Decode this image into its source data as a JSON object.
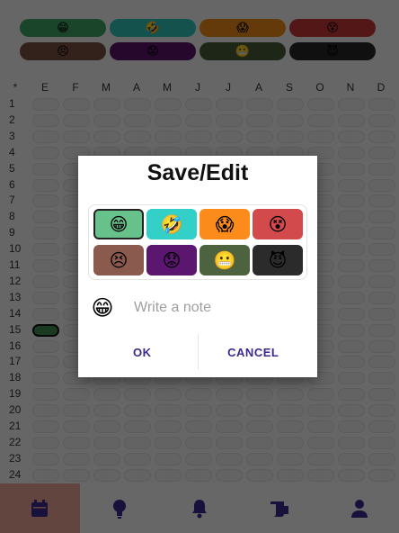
{
  "legend": [
    {
      "color": "#3fa565",
      "icon": "grinning-face-icon",
      "glyph": "😁"
    },
    {
      "color": "#2fc4b8",
      "icon": "laughing-face-icon",
      "glyph": "🤣"
    },
    {
      "color": "#f08a18",
      "icon": "shocked-face-icon",
      "glyph": "😱"
    },
    {
      "color": "#c9383a",
      "icon": "dizzy-face-icon",
      "glyph": "😵"
    },
    {
      "color": "#7b4f42",
      "icon": "sad-face-icon",
      "glyph": "😣"
    },
    {
      "color": "#5a1569",
      "icon": "worried-face-icon",
      "glyph": "😟"
    },
    {
      "color": "#465c37",
      "icon": "grimace-face-icon",
      "glyph": "😬"
    },
    {
      "color": "#262626",
      "icon": "devil-face-icon",
      "glyph": "😈"
    }
  ],
  "grid": {
    "corner": "*",
    "months": [
      "E",
      "F",
      "M",
      "A",
      "M",
      "J",
      "J",
      "A",
      "S",
      "O",
      "N",
      "D"
    ],
    "days": [
      "1",
      "2",
      "3",
      "4",
      "5",
      "6",
      "7",
      "8",
      "9",
      "10",
      "11",
      "12",
      "13",
      "14",
      "15",
      "16",
      "17",
      "18",
      "19",
      "20",
      "21",
      "22",
      "23",
      "24"
    ]
  },
  "dialog": {
    "title": "Save/Edit",
    "moods": [
      {
        "color": "#66c28a",
        "icon": "grinning-face-icon",
        "glyph": "😁",
        "selected": true
      },
      {
        "color": "#32d0c6",
        "icon": "laughing-face-icon",
        "glyph": "🤣",
        "selected": false
      },
      {
        "color": "#fb8c1c",
        "icon": "shocked-face-icon",
        "glyph": "😱",
        "selected": false
      },
      {
        "color": "#d24a4c",
        "icon": "dizzy-face-icon",
        "glyph": "😵",
        "selected": false
      },
      {
        "color": "#8a5a4f",
        "icon": "sad-face-icon",
        "glyph": "😣",
        "selected": false
      },
      {
        "color": "#5b1670",
        "icon": "worried-face-icon",
        "glyph": "😟",
        "selected": false
      },
      {
        "color": "#4d6340",
        "icon": "grimace-face-icon",
        "glyph": "😬",
        "selected": false
      },
      {
        "color": "#2b2b2b",
        "icon": "devil-face-icon",
        "glyph": "😈",
        "selected": false
      }
    ],
    "note_icon": "😁",
    "note_placeholder": "Write a note",
    "ok_label": "OK",
    "cancel_label": "CANCEL"
  },
  "tabbar": {
    "active_color": "#e8a493",
    "icon_color": "#3b2a8e",
    "tabs": [
      "calendar-icon",
      "lightbulb-icon",
      "bell-icon",
      "scroll-icon",
      "person-icon"
    ]
  }
}
